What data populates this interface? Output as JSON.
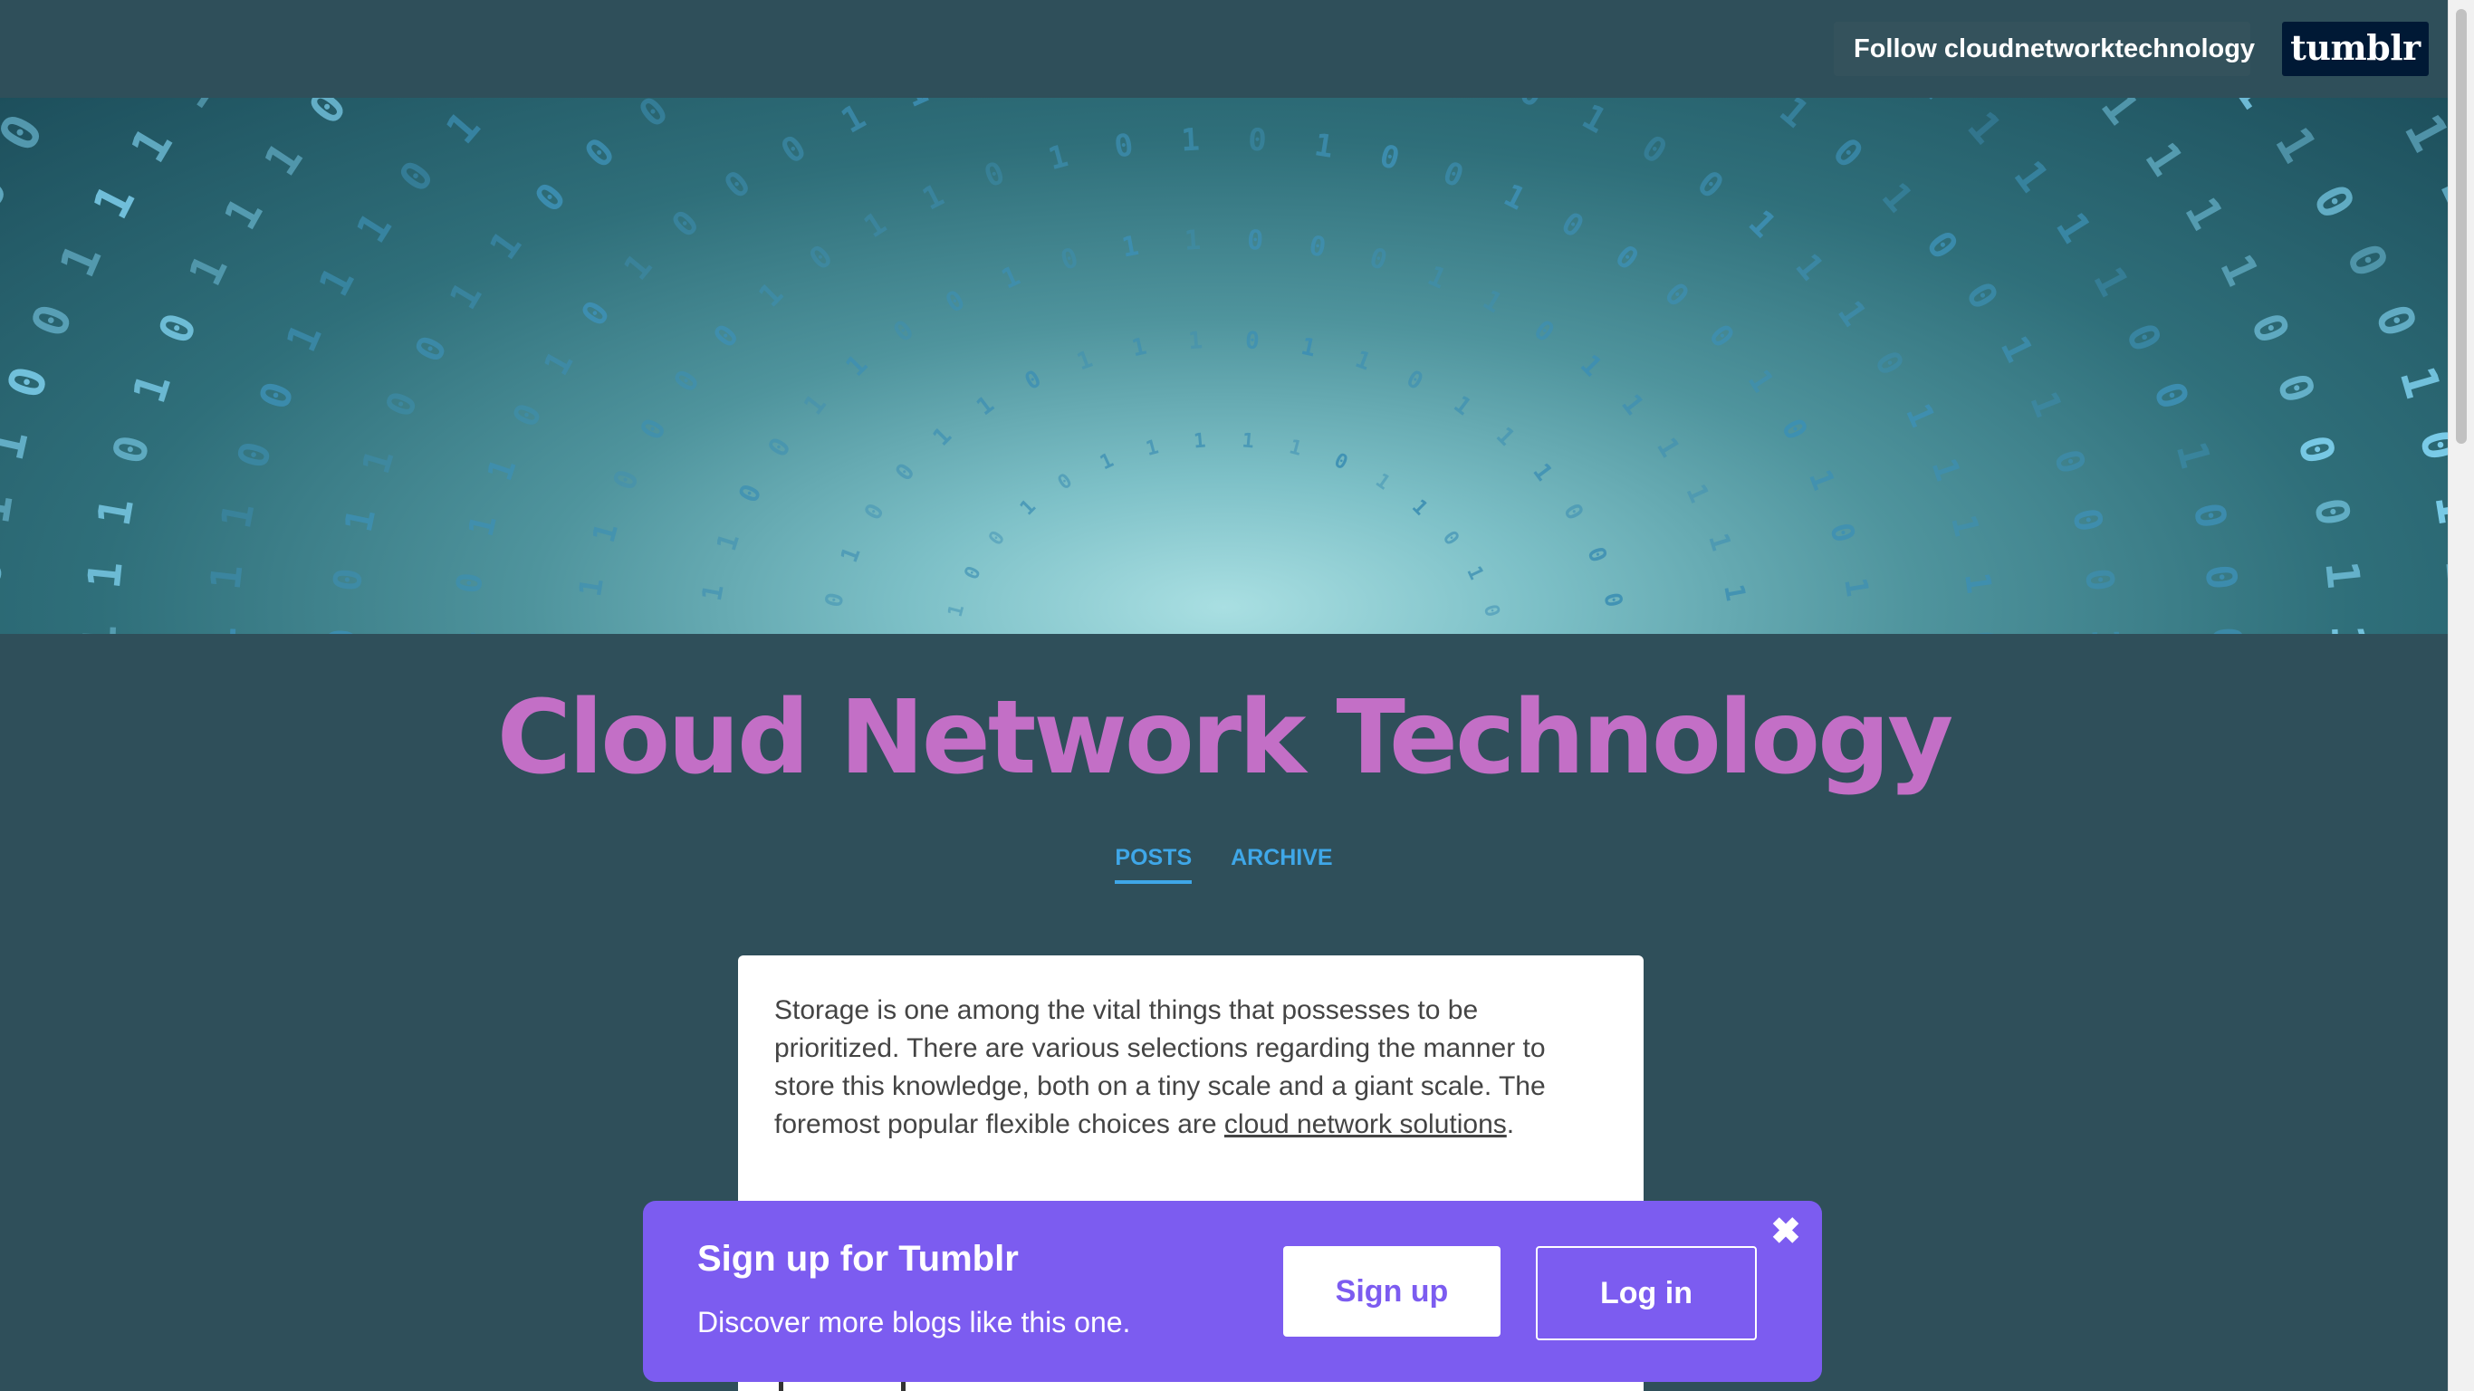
{
  "topbar": {
    "follow_label": "Follow cloudnetworktechnology",
    "logo_text": "tumblr"
  },
  "blog": {
    "title": "Cloud Network Technology",
    "nav": {
      "posts": "POSTS",
      "archive": "ARCHIVE"
    }
  },
  "post": {
    "text_before_link": "Storage is one among the vital things that possesses to be prioritized. There are various selections regarding the manner to store this knowledge, both on a tiny scale and a giant scale. The foremost popular flexible choices are ",
    "link_text": "cloud network solutions",
    "text_after_link": "."
  },
  "signup": {
    "title": "Sign up for Tumblr",
    "subtitle": "Discover more blogs like this one.",
    "signup_label": "Sign up",
    "login_label": "Log in",
    "close_glyph": "✖"
  },
  "colors": {
    "background": "#2f4f5a",
    "title": "#c36fc6",
    "nav_link": "#3fa7e8",
    "signup_banner": "#7c5cf0",
    "tumblr_logo_bg": "#001935"
  },
  "icons": {
    "header": "binary-tunnel-image",
    "close": "close-icon"
  }
}
